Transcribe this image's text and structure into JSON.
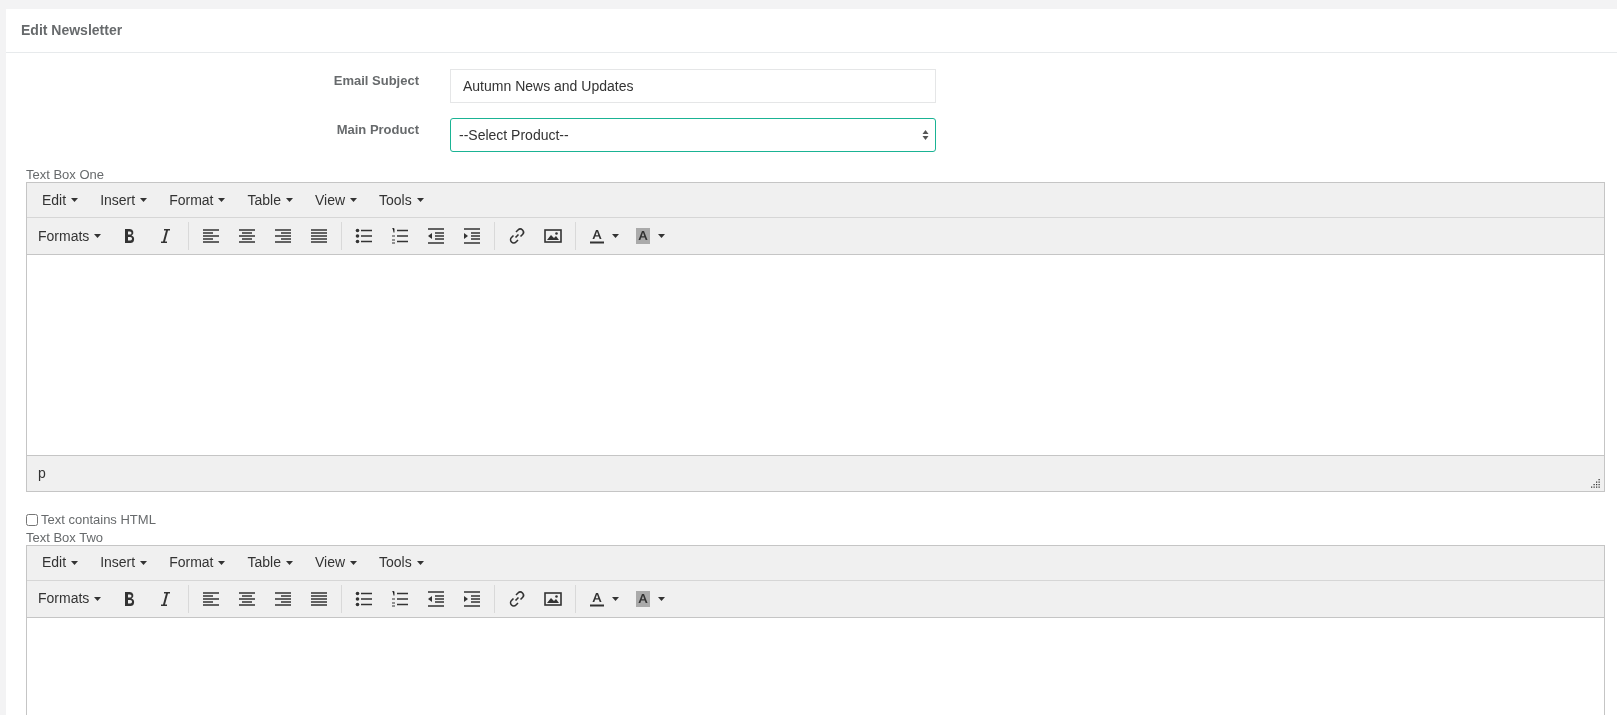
{
  "panel": {
    "title": "Edit Newsletter"
  },
  "form": {
    "fields": [
      {
        "kind": "text",
        "label": "Email Subject",
        "value": "Autumn News and Updates"
      },
      {
        "kind": "select",
        "label": "Main Product",
        "value": "--Select Product--",
        "focused": true
      }
    ]
  },
  "editors": [
    {
      "label": "Text Box One",
      "menus": [
        "Edit",
        "Insert",
        "Format",
        "Table",
        "View",
        "Tools"
      ],
      "formats": "Formats",
      "status_path": "p"
    },
    {
      "checkbox": {
        "label": "Text contains HTML",
        "checked": false
      },
      "label": "Text Box Two",
      "menus": [
        "Edit",
        "Insert",
        "Format",
        "Table",
        "View",
        "Tools"
      ],
      "formats": "Formats"
    }
  ]
}
